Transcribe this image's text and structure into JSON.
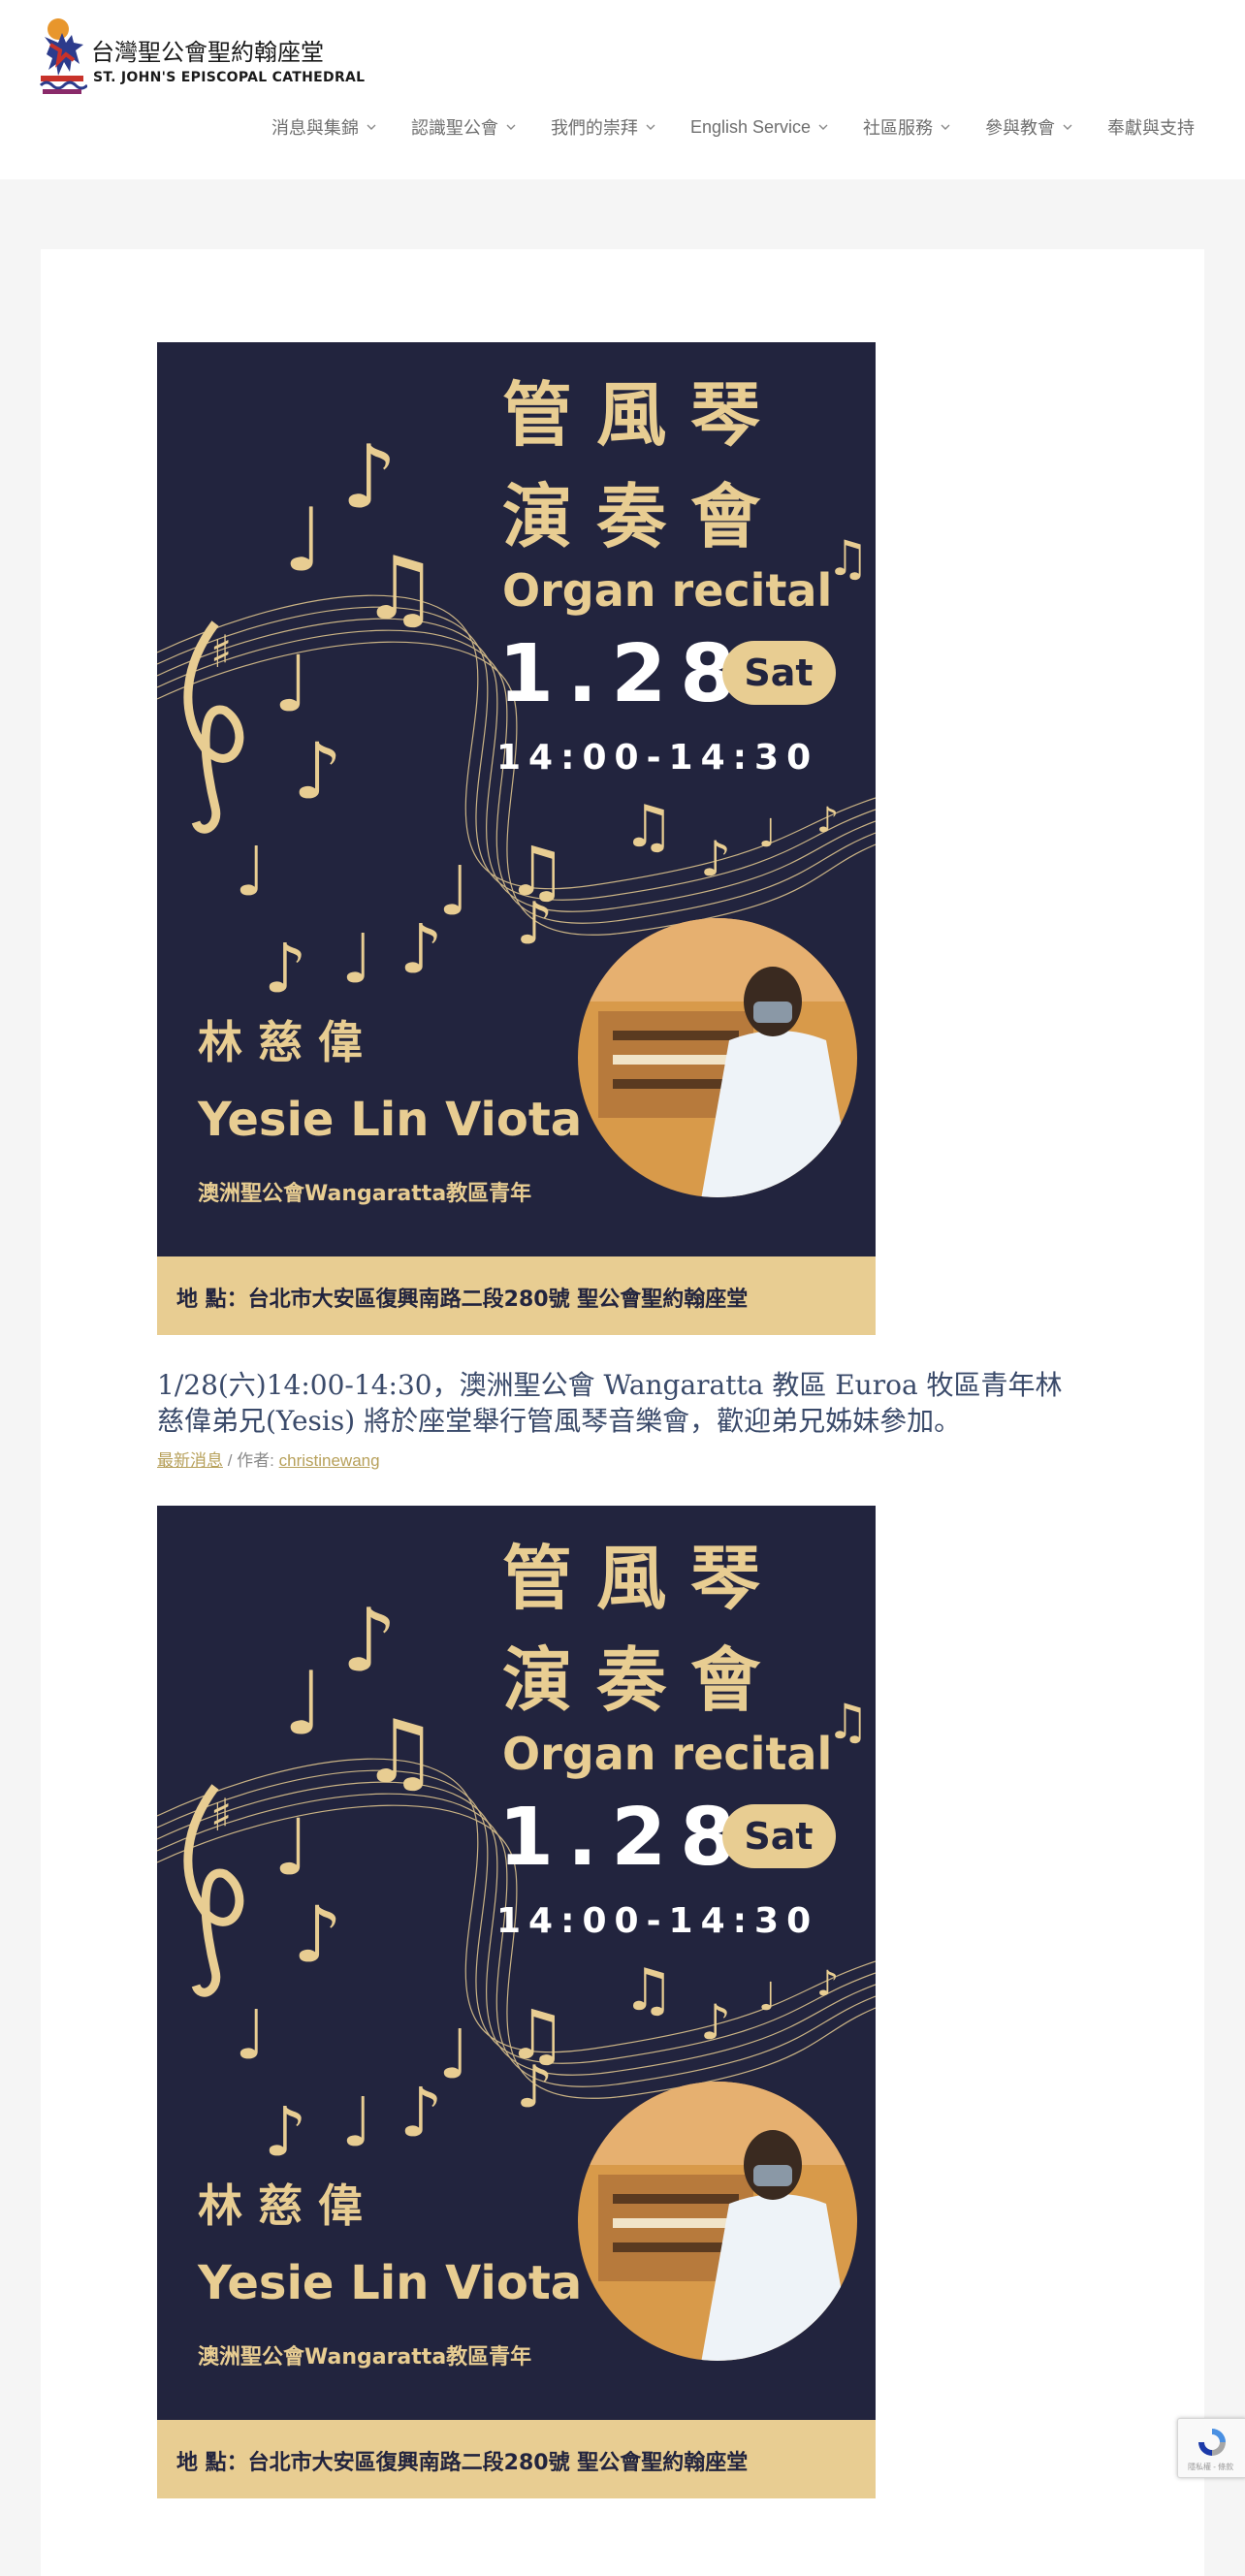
{
  "site": {
    "name_zh": "台灣聖公會聖約翰座堂",
    "name_en": "ST. JOHN'S EPISCOPAL CATHEDRAL"
  },
  "nav": {
    "items": [
      {
        "label": "消息與集錦",
        "has_dropdown": true
      },
      {
        "label": "認識聖公會",
        "has_dropdown": true
      },
      {
        "label": "我們的崇拜",
        "has_dropdown": true
      },
      {
        "label": "English Service",
        "has_dropdown": true
      },
      {
        "label": "社區服務",
        "has_dropdown": true
      },
      {
        "label": "參與教會",
        "has_dropdown": true
      },
      {
        "label": "奉獻與支持",
        "has_dropdown": false
      }
    ]
  },
  "poster": {
    "title_line1": "管 風 琴",
    "title_line2": "演 奏 會",
    "subtitle": "Organ recital",
    "date": "1.28",
    "day": "Sat",
    "time": "14:00-14:30",
    "performer_zh": "林 慈 偉",
    "performer_en": "Yesie Lin Viota",
    "performer_desc": "澳洲聖公會Wangaratta教區青年",
    "location": "地 點：台北市大安區復興南路二段280號 聖公會聖約翰座堂",
    "colors": {
      "background": "#22243e",
      "accent": "#e8cd92"
    }
  },
  "post": {
    "title": "1/28(六)14:00-14:30，澳洲聖公會 Wangaratta 教區 Euroa 牧區青年林慈偉弟兄(Yesis) 將於座堂舉行管風琴音樂會，歡迎弟兄姊妹參加。",
    "category": "最新消息",
    "author_prefix": " / 作者: ",
    "author": "christinewang"
  },
  "recaptcha": {
    "label": "隱私權 - 條款"
  }
}
